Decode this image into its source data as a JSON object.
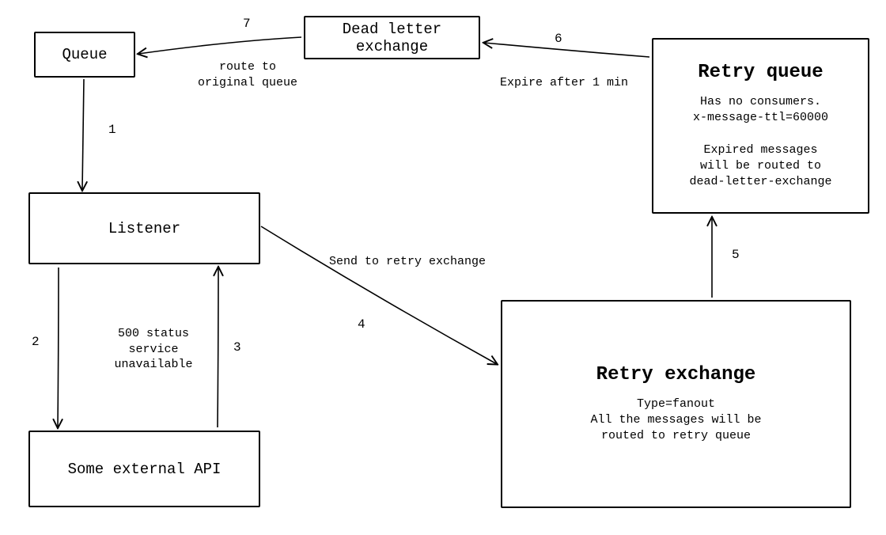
{
  "nodes": {
    "queue": {
      "title": "Queue"
    },
    "listener": {
      "title": "Listener"
    },
    "external_api": {
      "title": "Some external API"
    },
    "dlx": {
      "title": "Dead letter exchange"
    },
    "retry_exchange": {
      "title": "Retry exchange",
      "body": "Type=fanout\nAll the messages will be\nrouted to retry queue"
    },
    "retry_queue": {
      "title": "Retry queue",
      "body": "Has no consumers.\nx-message-ttl=60000\n\nExpired messages\nwill be routed to\ndead-letter-exchange"
    }
  },
  "edges": {
    "e1": {
      "step": "1",
      "label": ""
    },
    "e2": {
      "step": "2",
      "label": ""
    },
    "e3": {
      "step": "3",
      "label": "500 status\nservice unavailable"
    },
    "e4": {
      "step": "4",
      "label": "Send to retry exchange"
    },
    "e5": {
      "step": "5",
      "label": ""
    },
    "e6": {
      "step": "6",
      "label": "Expire after 1 min"
    },
    "e7": {
      "step": "7",
      "label": "route to\noriginal queue"
    }
  }
}
